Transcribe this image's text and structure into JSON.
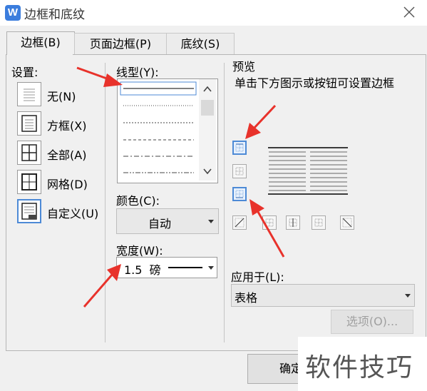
{
  "window": {
    "title": "边框和底纹",
    "app_icon_letter": "W"
  },
  "tabs": [
    {
      "label": "边框(B)"
    },
    {
      "label": "页面边框(P)"
    },
    {
      "label": "底纹(S)"
    }
  ],
  "settings": {
    "label": "设置:",
    "items": [
      {
        "label": "无(N)"
      },
      {
        "label": "方框(X)"
      },
      {
        "label": "全部(A)"
      },
      {
        "label": "网格(D)"
      },
      {
        "label": "自定义(U)"
      }
    ]
  },
  "line_style": {
    "label": "线型(Y):"
  },
  "color": {
    "label": "颜色(C):",
    "value": "自动"
  },
  "width": {
    "label": "宽度(W):",
    "value": "1.5  磅"
  },
  "preview": {
    "label": "预览",
    "hint": "单击下方图示或按钮可设置边框"
  },
  "apply_to": {
    "label": "应用于(L):",
    "value": "表格"
  },
  "buttons": {
    "options": "选项(O)...",
    "ok": "确定"
  },
  "watermark": "软件技巧",
  "colors": {
    "accent": "#4d8ad6",
    "annotation_arrow": "#e8322b",
    "app_icon": "#3b7ddd"
  }
}
